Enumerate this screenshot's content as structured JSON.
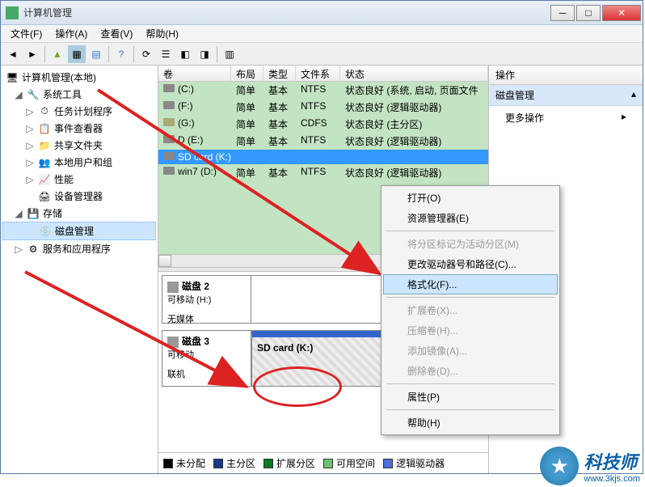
{
  "window": {
    "title": "计算机管理"
  },
  "menubar": {
    "file": "文件(F)",
    "action": "操作(A)",
    "view": "查看(V)",
    "help": "帮助(H)"
  },
  "tree": {
    "root": "计算机管理(本地)",
    "system_tools": "系统工具",
    "task_scheduler": "任务计划程序",
    "event_viewer": "事件查看器",
    "shared_folders": "共享文件夹",
    "local_users": "本地用户和组",
    "performance": "性能",
    "device_manager": "设备管理器",
    "storage": "存储",
    "disk_management": "磁盘管理",
    "services_apps": "服务和应用程序"
  },
  "volumes": {
    "headers": {
      "volume": "卷",
      "layout": "布局",
      "type": "类型",
      "fs": "文件系统",
      "status": "状态"
    },
    "rows": [
      {
        "name": "(C:)",
        "layout": "简单",
        "type": "基本",
        "fs": "NTFS",
        "status": "状态良好 (系统, 启动, 页面文件"
      },
      {
        "name": "(F:)",
        "layout": "简单",
        "type": "基本",
        "fs": "NTFS",
        "status": "状态良好 (逻辑驱动器)"
      },
      {
        "name": "(G:)",
        "layout": "简单",
        "type": "基本",
        "fs": "CDFS",
        "status": "状态良好 (主分区)"
      },
      {
        "name": "D (E:)",
        "layout": "简单",
        "type": "基本",
        "fs": "NTFS",
        "status": "状态良好 (逻辑驱动器)"
      },
      {
        "name": "SD card (K:)",
        "layout": "",
        "type": "",
        "fs": "",
        "status": ""
      },
      {
        "name": "win7 (D:)",
        "layout": "简单",
        "type": "基本",
        "fs": "NTFS",
        "status": "状态良好 (逻辑驱动器)"
      }
    ]
  },
  "disks": {
    "disk2": {
      "title": "磁盘 2",
      "removable": "可移动 (H:)",
      "status": "无媒体"
    },
    "disk3": {
      "title": "磁盘 3",
      "removable": "可移动",
      "status": "联机",
      "vol": "SD card  (K:)"
    }
  },
  "legend": {
    "unalloc": "未分配",
    "primary": "主分区",
    "extended": "扩展分区",
    "free": "可用空间",
    "logical": "逻辑驱动器"
  },
  "actions": {
    "header": "操作",
    "section": "磁盘管理",
    "more": "更多操作"
  },
  "context": {
    "open": "打开(O)",
    "explorer": "资源管理器(E)",
    "mark_active": "将分区标记为活动分区(M)",
    "change_letter": "更改驱动器号和路径(C)...",
    "format": "格式化(F)...",
    "extend": "扩展卷(X)...",
    "shrink": "压缩卷(H)...",
    "mirror": "添加镜像(A)...",
    "delete": "删除卷(D)...",
    "properties": "属性(P)",
    "help": "帮助(H)"
  },
  "watermark": {
    "brand": "科技师",
    "url": "www.3kjs.com"
  },
  "colors": {
    "unalloc": "#000000",
    "primary": "#1a3a8a",
    "extended": "#0a7a1a",
    "free": "#6ec06e",
    "logical": "#4a6fd8"
  }
}
